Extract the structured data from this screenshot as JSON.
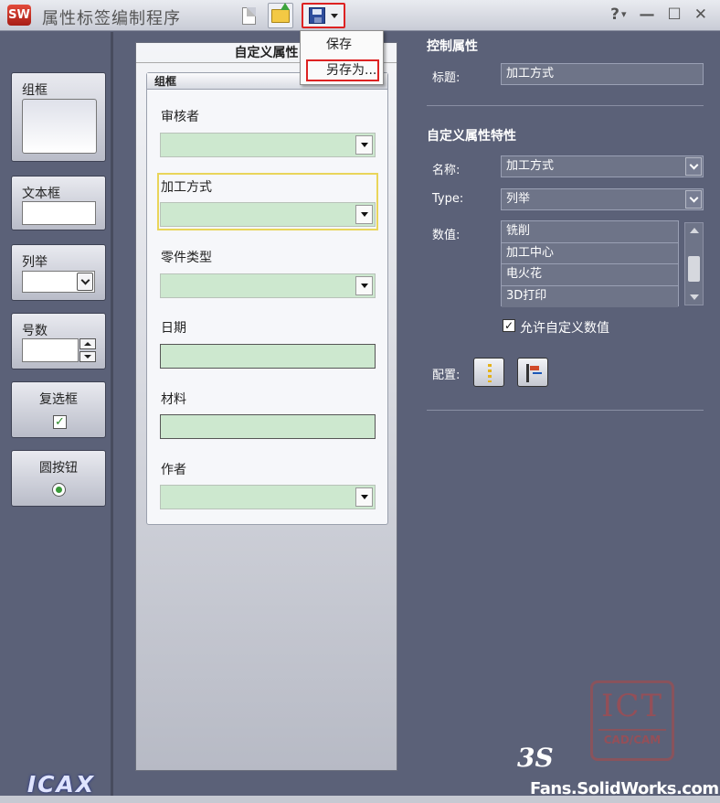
{
  "app": {
    "logo_text": "SW",
    "title": "属性标签编制程序",
    "window_controls": [
      "?",
      "▾",
      "—",
      "☐",
      "✕"
    ]
  },
  "toolbar": {
    "new_icon": "new-document-icon",
    "open_icon": "open-folder-icon",
    "save_icon": "save-disk-icon"
  },
  "save_menu": {
    "items": [
      "保存",
      "另存为..."
    ]
  },
  "toolbox": {
    "group_label": "组框",
    "textbox_label": "文本框",
    "enum_label": "列举",
    "number_label": "号数",
    "checkbox_label": "复选框",
    "radio_label": "圆按钮"
  },
  "form": {
    "title": "自定义属性",
    "groupbox_title": "组框",
    "fields": [
      {
        "label": "审核者",
        "type": "combo"
      },
      {
        "label": "加工方式",
        "type": "combo",
        "selected": true
      },
      {
        "label": "零件类型",
        "type": "combo"
      },
      {
        "label": "日期",
        "type": "text"
      },
      {
        "label": "材料",
        "type": "text"
      },
      {
        "label": "作者",
        "type": "combo"
      }
    ]
  },
  "properties": {
    "control_section": "控制属性",
    "caption_label": "标题:",
    "caption_value": "加工方式",
    "custom_section": "自定义属性特性",
    "name_label": "名称:",
    "name_value": "加工方式",
    "type_label": "Type:",
    "type_value": "列举",
    "values_label": "数值:",
    "values": [
      "铣削",
      "加工中心",
      "电火花",
      "3D打印"
    ],
    "allow_custom_label": "允许自定义数值",
    "allow_custom_checked": true,
    "config_label": "配置:"
  },
  "watermarks": {
    "ict_big": "ICT",
    "ict_small": "CAD/CAM",
    "icax": "ICAX",
    "fans_logo": "3S",
    "fans": "Fans.SolidWorks.com.cn"
  }
}
